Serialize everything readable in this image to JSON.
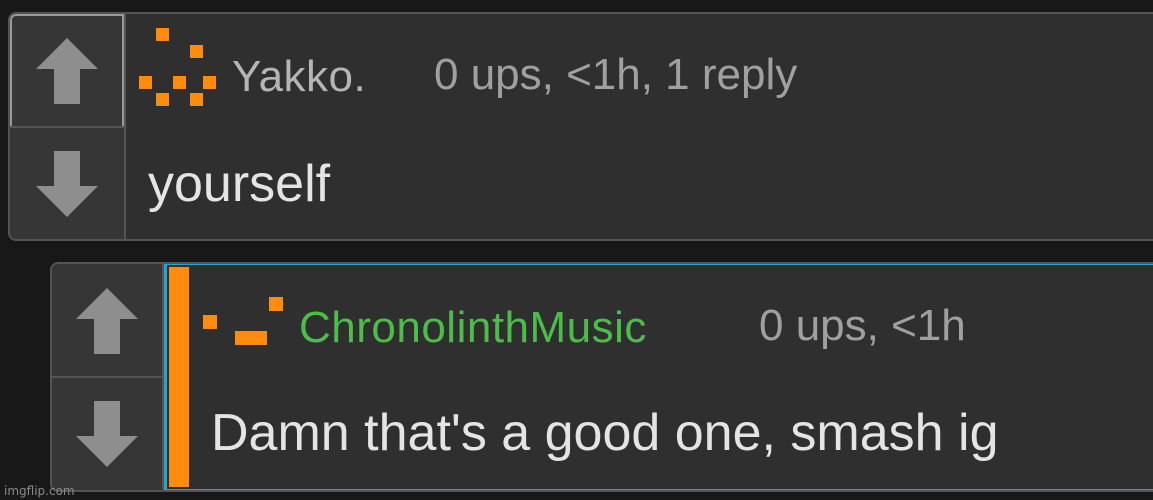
{
  "colors": {
    "background": "#181818",
    "card": "#2f2f2f",
    "border": "#545454",
    "accent_orange": "#ff8c0d",
    "highlight_blue": "#1aa7d8",
    "op_username_green": "#4cbd48"
  },
  "comments": [
    {
      "username": "Yakko.",
      "meta": "0 ups, <1h, 1 reply",
      "text": "yourself",
      "upvote_icon": "arrow-up-icon",
      "downvote_icon": "arrow-down-icon"
    },
    {
      "username": "ChronolinthMusic",
      "meta": "0 ups, <1h",
      "text": "Damn that's a good one, smash ig",
      "upvote_icon": "arrow-up-icon",
      "downvote_icon": "arrow-down-icon"
    }
  ],
  "watermark": "imgflip.com"
}
